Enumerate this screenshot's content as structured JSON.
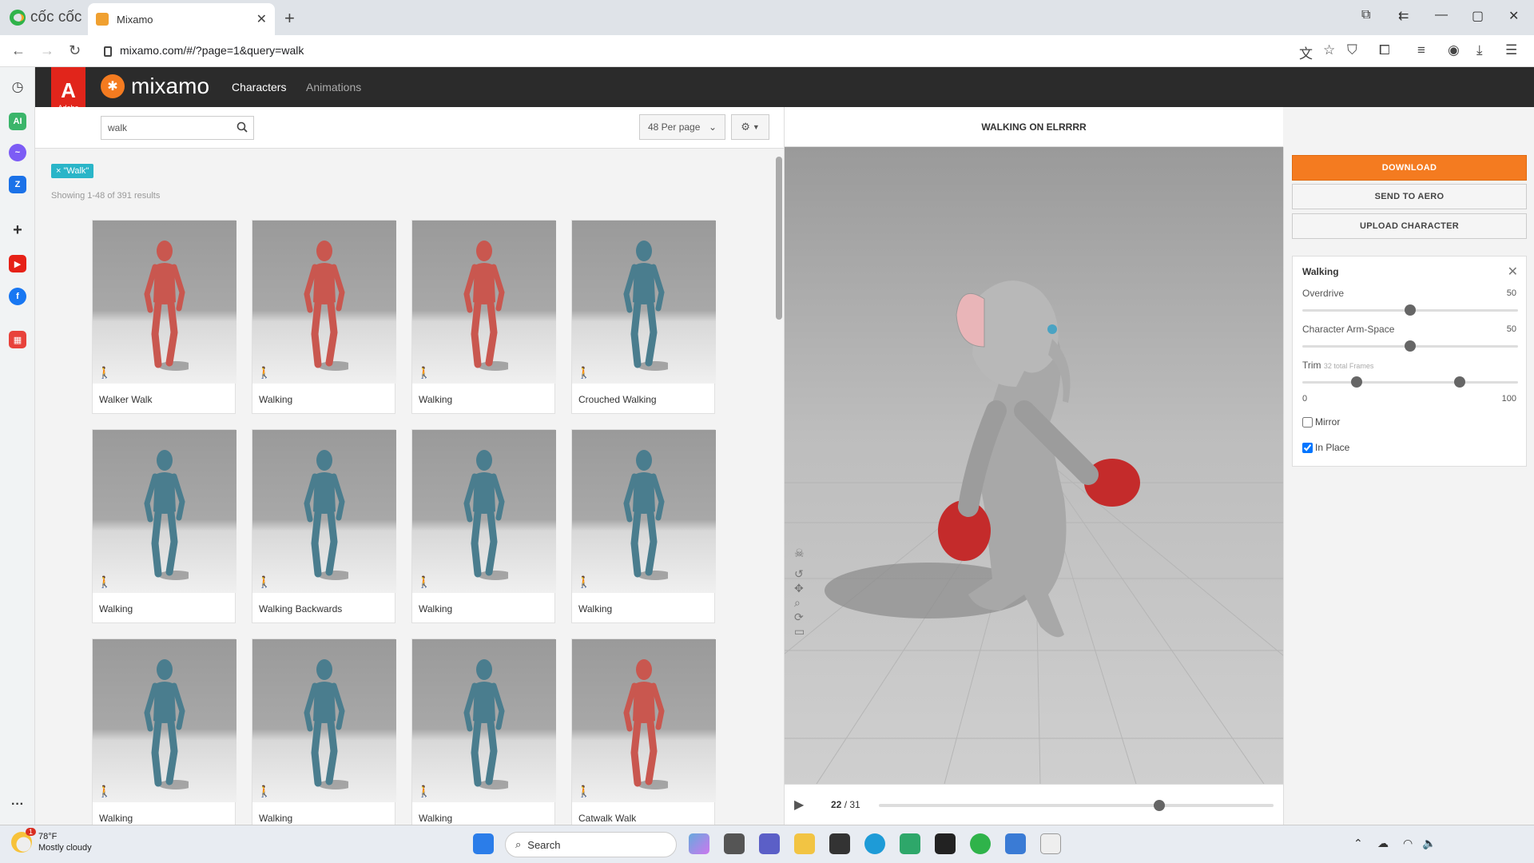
{
  "browser": {
    "brand": "cốc cốc",
    "tab_title": "Mixamo",
    "url": "mixamo.com/#/?page=1&query=walk"
  },
  "header": {
    "adobe_label": "Adobe",
    "logo_text": "mixamo",
    "nav": [
      "Characters",
      "Animations"
    ]
  },
  "search": {
    "query": "walk",
    "per_page": "48 Per page",
    "filter_tag": "× \"Walk\"",
    "results_text": "Showing 1-48 of 391 results"
  },
  "cards": [
    {
      "label": "Walker Walk",
      "char": "red"
    },
    {
      "label": "Walking",
      "char": "red"
    },
    {
      "label": "Walking",
      "char": "red"
    },
    {
      "label": "Crouched Walking",
      "char": "blue"
    },
    {
      "label": "Walking",
      "char": "blue"
    },
    {
      "label": "Walking Backwards",
      "char": "blue"
    },
    {
      "label": "Walking",
      "char": "blue"
    },
    {
      "label": "Walking",
      "char": "blue"
    },
    {
      "label": "Walking",
      "char": "blue"
    },
    {
      "label": "Walking",
      "char": "blue"
    },
    {
      "label": "Walking",
      "char": "blue"
    },
    {
      "label": "Catwalk Walk",
      "char": "red"
    }
  ],
  "viewer": {
    "title": "WALKING ON ELRRRR",
    "frame_current": "22",
    "frame_total": "/ 31",
    "progress_fraction": 0.71
  },
  "actions": {
    "download": "DOWNLOAD",
    "send_to_aero": "SEND TO AERO",
    "upload_character": "UPLOAD CHARACTER"
  },
  "settings": {
    "title": "Walking",
    "overdrive": {
      "label": "Overdrive",
      "value": "50",
      "fraction": 0.5
    },
    "arm_space": {
      "label": "Character Arm-Space",
      "value": "50",
      "fraction": 0.5
    },
    "trim": {
      "label": "Trim",
      "hint": "32 total Frames",
      "min": "0",
      "max": "100",
      "start_fraction": 0.25,
      "end_fraction": 0.73
    },
    "mirror": {
      "label": "Mirror",
      "checked": false
    },
    "in_place": {
      "label": "In Place",
      "checked": true
    }
  },
  "taskbar": {
    "temp": "78°F",
    "condition": "Mostly cloudy",
    "search_placeholder": "Search",
    "notification_count": "1"
  },
  "colors": {
    "accent_orange": "#f47b20",
    "tag_teal": "#2ab5c8",
    "adobe_red": "#e1251b",
    "red_char": "#c9574f",
    "blue_char": "#4a7d8e"
  }
}
